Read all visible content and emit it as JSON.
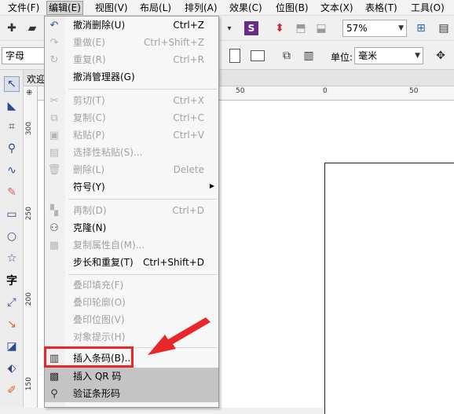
{
  "menubar": [
    {
      "label": "文件(F)"
    },
    {
      "label": "编辑(E)"
    },
    {
      "label": "视图(V)"
    },
    {
      "label": "布局(L)"
    },
    {
      "label": "排列(A)"
    },
    {
      "label": "效果(C)"
    },
    {
      "label": "位图(B)"
    },
    {
      "label": "文本(X)"
    },
    {
      "label": "表格(T)"
    },
    {
      "label": "工具(O)"
    }
  ],
  "toolbar": {
    "zoom_value": "57%",
    "font_field": "字母",
    "unit_label": "单位:",
    "unit_value": "毫米"
  },
  "doc_tab": "欢迎",
  "rulers": {
    "horizontal": [
      "50",
      "0",
      "50"
    ],
    "vertical": [
      "300",
      "250",
      "200",
      "150"
    ]
  },
  "edit_menu": {
    "items": [
      {
        "label": "撤消删除(U)",
        "shortcut": "Ctrl+Z",
        "enabled": true,
        "icon": "undo-icon"
      },
      {
        "label": "重做(E)",
        "shortcut": "Ctrl+Shift+Z",
        "enabled": false,
        "icon": "redo-icon"
      },
      {
        "label": "重复(R)",
        "shortcut": "Ctrl+R",
        "enabled": false,
        "icon": "repeat-icon"
      },
      {
        "label": "撤消管理器(G)",
        "shortcut": "",
        "enabled": true,
        "icon": ""
      },
      {
        "label": "剪切(T)",
        "shortcut": "Ctrl+X",
        "enabled": false,
        "icon": "cut-icon"
      },
      {
        "label": "复制(C)",
        "shortcut": "Ctrl+C",
        "enabled": false,
        "icon": "copy-icon"
      },
      {
        "label": "粘贴(P)",
        "shortcut": "Ctrl+V",
        "enabled": false,
        "icon": "paste-icon"
      },
      {
        "label": "选择性粘贴(S)...",
        "shortcut": "",
        "enabled": false,
        "icon": "paste-special-icon"
      },
      {
        "label": "删除(L)",
        "shortcut": "Delete",
        "enabled": false,
        "icon": "delete-icon"
      },
      {
        "label": "符号(Y)",
        "shortcut": "",
        "enabled": true,
        "icon": ""
      },
      {
        "label": "再制(D)",
        "shortcut": "Ctrl+D",
        "enabled": false,
        "icon": "duplicate-icon"
      },
      {
        "label": "克隆(N)",
        "shortcut": "",
        "enabled": true,
        "icon": "clone-icon"
      },
      {
        "label": "复制属性自(M)...",
        "shortcut": "",
        "enabled": false,
        "icon": "copy-properties-icon"
      },
      {
        "label": "步长和重复(T)",
        "shortcut": "Ctrl+Shift+D",
        "enabled": true,
        "icon": ""
      },
      {
        "label": "叠印填充(F)",
        "shortcut": "",
        "enabled": false,
        "icon": ""
      },
      {
        "label": "叠印轮廓(O)",
        "shortcut": "",
        "enabled": false,
        "icon": ""
      },
      {
        "label": "叠印位图(V)",
        "shortcut": "",
        "enabled": false,
        "icon": ""
      },
      {
        "label": "对象提示(H)",
        "shortcut": "",
        "enabled": false,
        "icon": ""
      },
      {
        "label": "插入条码(B)...",
        "shortcut": "",
        "enabled": true,
        "icon": "barcode-icon"
      },
      {
        "label": "插入 QR 码",
        "shortcut": "",
        "enabled": true,
        "icon": "qr-code-icon"
      },
      {
        "label": "验证条形码",
        "shortcut": "",
        "enabled": true,
        "icon": "validate-barcode-icon"
      }
    ]
  },
  "annotation_color": "#e8272a"
}
